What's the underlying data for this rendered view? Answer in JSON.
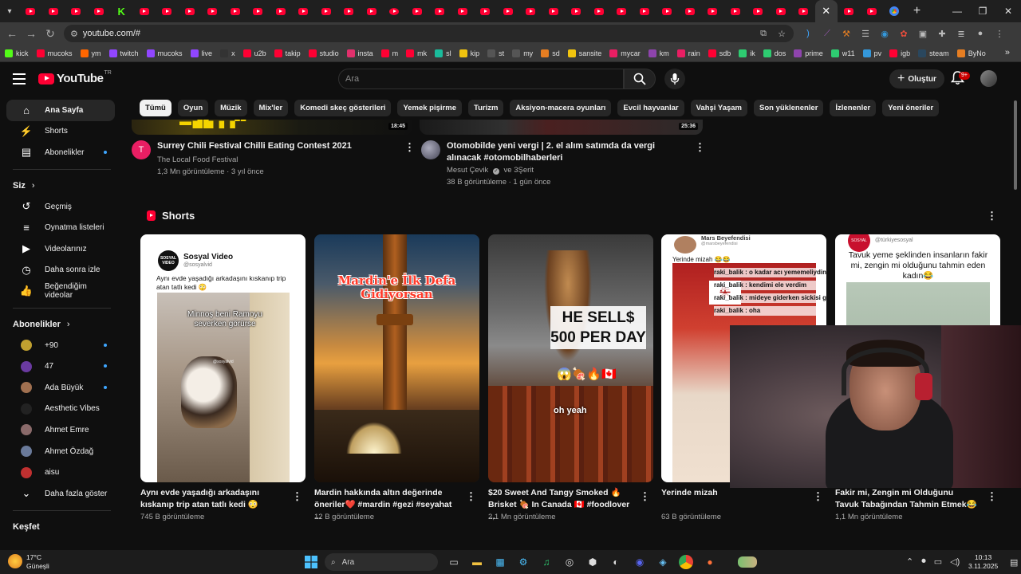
{
  "browser": {
    "active_tab_close": "✕",
    "new_tab": "+",
    "url": "youtube.com/#",
    "bookmarks": [
      {
        "label": "kick",
        "color": "#53fc18"
      },
      {
        "label": "mucoks",
        "color": "#ff0033"
      },
      {
        "label": "ym",
        "color": "#ff6600"
      },
      {
        "label": "twitch",
        "color": "#9146ff"
      },
      {
        "label": "mucoks",
        "color": "#9146ff"
      },
      {
        "label": "live",
        "color": "#9146ff"
      },
      {
        "label": "x",
        "color": "#333333"
      },
      {
        "label": "u2b",
        "color": "#ff0033"
      },
      {
        "label": "takip",
        "color": "#ff0033"
      },
      {
        "label": "studio",
        "color": "#ff0033"
      },
      {
        "label": "insta",
        "color": "#e1306c"
      },
      {
        "label": "m",
        "color": "#ff0033"
      },
      {
        "label": "mk",
        "color": "#ff0033"
      },
      {
        "label": "sl",
        "color": "#1abc9c"
      },
      {
        "label": "kip",
        "color": "#f1c40f"
      },
      {
        "label": "st",
        "color": "#555555"
      },
      {
        "label": "my",
        "color": "#555555"
      },
      {
        "label": "sd",
        "color": "#e67e22"
      },
      {
        "label": "sansite",
        "color": "#f1c40f"
      },
      {
        "label": "mycar",
        "color": "#e91e63"
      },
      {
        "label": "km",
        "color": "#8e44ad"
      },
      {
        "label": "rain",
        "color": "#e91e63"
      },
      {
        "label": "sdb",
        "color": "#ff0033"
      },
      {
        "label": "ik",
        "color": "#2ecc71"
      },
      {
        "label": "dos",
        "color": "#2ecc71"
      },
      {
        "label": "prime",
        "color": "#8e44ad"
      },
      {
        "label": "w11",
        "color": "#2ecc71"
      },
      {
        "label": "pv",
        "color": "#3498db"
      },
      {
        "label": "igb",
        "color": "#ff0033"
      },
      {
        "label": "steam",
        "color": "#2a475e"
      },
      {
        "label": "ByNo",
        "color": "#e67e22"
      }
    ],
    "more_bookmarks": "»"
  },
  "youtube": {
    "logo_text": "YouTube",
    "logo_sup": "TR",
    "search_placeholder": "Ara",
    "create_label": "Oluştur",
    "notif_count": "9+",
    "chips": [
      "Tümü",
      "Oyun",
      "Müzik",
      "Mix'ler",
      "Komedi skeç gösterileri",
      "Yemek pişirme",
      "Turizm",
      "Aksiyon-macera oyunları",
      "Evcil hayvanlar",
      "Vahşi Yaşam",
      "Son yüklenenler",
      "İzlenenler",
      "Yeni öneriler"
    ],
    "sidebar": {
      "main": [
        {
          "label": "Ana Sayfa",
          "icon": "home-icon",
          "glyph": "⌂",
          "active": true
        },
        {
          "label": "Shorts",
          "icon": "shorts-icon",
          "glyph": "⚡",
          "active": false
        },
        {
          "label": "Abonelikler",
          "icon": "subscriptions-icon",
          "glyph": "▤",
          "active": false,
          "dot": true
        }
      ],
      "you_heading": "Siz",
      "you": [
        {
          "label": "Geçmiş",
          "icon": "history-icon",
          "glyph": "↺"
        },
        {
          "label": "Oynatma listeleri",
          "icon": "playlists-icon",
          "glyph": "≡"
        },
        {
          "label": "Videolarınız",
          "icon": "your-videos-icon",
          "glyph": "▶"
        },
        {
          "label": "Daha sonra izle",
          "icon": "watch-later-icon",
          "glyph": "◷"
        },
        {
          "label": "Beğendiğim videolar",
          "icon": "liked-icon",
          "glyph": "👍"
        }
      ],
      "subs_heading": "Abonelikler",
      "subs": [
        {
          "label": "+90",
          "color": "#c0a030",
          "dot": true
        },
        {
          "label": "47",
          "color": "#6a3aa0",
          "dot": true
        },
        {
          "label": "Ada Büyük",
          "color": "#a07050",
          "dot": true
        },
        {
          "label": "Aesthetic Vibes",
          "color": "#222222",
          "dot": false
        },
        {
          "label": "Ahmet Emre",
          "color": "#8a6a6a",
          "dot": false
        },
        {
          "label": "Ahmet Özdağ",
          "color": "#6a7a9a",
          "dot": false
        },
        {
          "label": "aisu",
          "color": "#c03030",
          "dot": false
        }
      ],
      "show_more": "Daha fazla göster",
      "explore_heading": "Keşfet"
    },
    "top_videos": [
      {
        "title": "Surrey Chili Festival Chilli Eating Contest 2021",
        "channel": "The Local Food Festival",
        "meta": "1,3 Mn görüntüleme · 3 yıl önce",
        "duration": "18:45",
        "avatar_letter": "T",
        "avatar_color": "#e91e63"
      },
      {
        "title": "Otomobilde yeni vergi | 2. el alım satımda da vergi alınacak #otomobilhaberleri",
        "channel": "Mesut Çevik",
        "channel_extra": "ve 3Şerit",
        "meta": "38 B görüntüleme · 1 gün önce",
        "duration": "25:36",
        "avatar_letter": "",
        "avatar_color": "#556677"
      }
    ],
    "shorts_heading": "Shorts",
    "shorts": [
      {
        "title": "Aynı evde yaşadığı arkadaşını kıskanıp trip atan tatlı kedi 😳",
        "views": "745 B görüntüleme",
        "overlay_header": "Sosyal Video",
        "overlay_handle": "@sosyalvid",
        "overlay_caption": "Aynı evde yaşadığı arkadaşını kıskanıp trip atan tatlı kedi 😳",
        "overlay_text": "Minnoş beni Ramoyu severken görürse",
        "overlay_watermark": "@sosyalvid"
      },
      {
        "title": "Mardin hakkında altın değerinde öneriler❤️ #mardin #gezi #seyahat ...",
        "views": "12 B görüntüleme",
        "overlay_text": "Mardin'e İlk Defa Gidiyorsan"
      },
      {
        "title": "$20 Sweet And Tangy Smoked 🔥 Brisket 🍖 In Canada 🇨🇦 #foodlover ...",
        "views": "2,1 Mn görüntüleme",
        "overlay_text": "HE SELL$ 500 PER DAY",
        "overlay_emoji": "😱🍖🔥🇨🇦",
        "overlay_sub": "oh yeah"
      },
      {
        "title": "Yerinde mizah",
        "views": "63 B görüntüleme",
        "overlay_header": "Mars Beyefendisi",
        "overlay_handle": "@marsbeyefendisi",
        "overlay_caption": "Yerinde mizah 😂😂",
        "overlay_lines": [
          "raki_balik : o kadar acı yememeliydin",
          "raki_balik : kendimi ele verdim",
          "raki_balik : mideye giderken sickisi geçiyor benim yediklerim",
          "raki_balik : oha"
        ]
      },
      {
        "title": "Fakir mi, Zengin mi Olduğunu Tavuk Tabağından Tahmin Etmek😂",
        "views": "1,1 Mn görüntüleme",
        "overlay_handle": "@türkiyesosyal",
        "overlay_caption": "Tavuk yeme şeklinden insanların fakir mi, zengin mi olduğunu tahmin eden kadın😂"
      }
    ]
  },
  "taskbar": {
    "weather_temp": "17°C",
    "weather_place": "Güneşli",
    "search": "Ara",
    "time": "10:13",
    "date": "3.11.2025"
  }
}
